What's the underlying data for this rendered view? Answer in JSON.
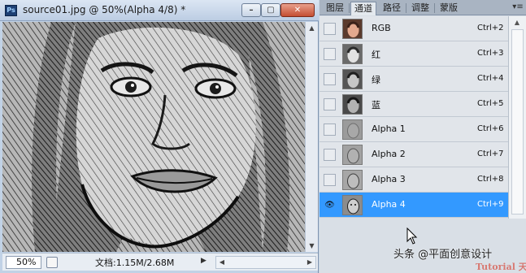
{
  "document": {
    "app_icon": "Ps",
    "title": "source01.jpg @ 50%(Alpha 4/8) *",
    "window_buttons": {
      "minimize": "–",
      "maximize": "▢",
      "close": "✕"
    },
    "zoom": "50%",
    "doc_info": "文档:1.15M/2.68M"
  },
  "panel": {
    "tabs": [
      {
        "label": "图层",
        "active": false
      },
      {
        "label": "通道",
        "active": true
      },
      {
        "label": "路径",
        "active": false
      },
      {
        "label": "调整",
        "active": false
      },
      {
        "label": "蒙版",
        "active": false
      }
    ],
    "menu_icon": "panel-menu-icon",
    "channels": [
      {
        "name": "RGB",
        "shortcut": "Ctrl+2",
        "visible": false,
        "selected": false,
        "thumb": "color"
      },
      {
        "name": "红",
        "shortcut": "Ctrl+3",
        "visible": false,
        "selected": false,
        "thumb": "gray"
      },
      {
        "name": "绿",
        "shortcut": "Ctrl+4",
        "visible": false,
        "selected": false,
        "thumb": "gray"
      },
      {
        "name": "蓝",
        "shortcut": "Ctrl+5",
        "visible": false,
        "selected": false,
        "thumb": "gray"
      },
      {
        "name": "Alpha 1",
        "shortcut": "Ctrl+6",
        "visible": false,
        "selected": false,
        "thumb": "emboss"
      },
      {
        "name": "Alpha 2",
        "shortcut": "Ctrl+7",
        "visible": false,
        "selected": false,
        "thumb": "emboss"
      },
      {
        "name": "Alpha 3",
        "shortcut": "Ctrl+8",
        "visible": false,
        "selected": false,
        "thumb": "emboss"
      },
      {
        "name": "Alpha 4",
        "shortcut": "Ctrl+9",
        "visible": true,
        "selected": true,
        "thumb": "emboss"
      }
    ]
  },
  "watermark": {
    "text": "头条 @平面创意设计",
    "sub": "Tutorial  天天"
  },
  "colors": {
    "selection": "#3399ff",
    "title_bar": "#c8d8ec",
    "panel_bg": "#d9dfe6"
  }
}
